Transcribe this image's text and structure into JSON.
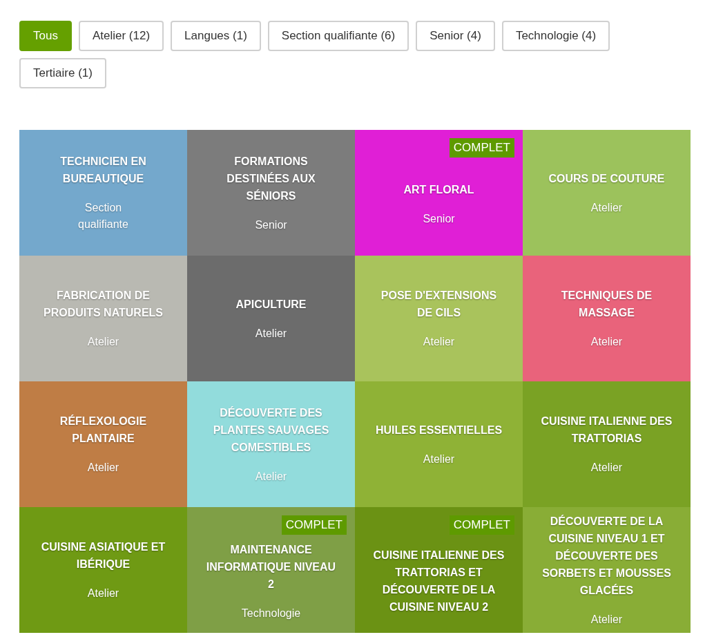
{
  "filters": [
    {
      "label": "Tous",
      "selected": true
    },
    {
      "label": "Atelier (12)",
      "selected": false
    },
    {
      "label": "Langues (1)",
      "selected": false
    },
    {
      "label": "Section qualifiante (6)",
      "selected": false
    },
    {
      "label": "Senior (4)",
      "selected": false
    },
    {
      "label": "Technologie (4)",
      "selected": false
    },
    {
      "label": "Tertiaire (1)",
      "selected": false
    }
  ],
  "courses": [
    {
      "title": "TECHNICIEN EN BUREAUTIQUE",
      "category": "Section qualifiante",
      "color": "#74a8cc"
    },
    {
      "title": "FORMATIONS DESTINÉES AUX SÉNIORS",
      "category": "Senior",
      "color": "#7c7c7c"
    },
    {
      "title": "ART FLORAL",
      "category": "Senior",
      "color": "#e01fd6",
      "badge": "COMPLET"
    },
    {
      "title": "COURS DE COUTURE",
      "category": "Atelier",
      "color": "#9cc25c"
    },
    {
      "title": "FABRICATION DE PRODUITS NATURELS",
      "category": "Atelier",
      "color": "#b9b9b2"
    },
    {
      "title": "APICULTURE",
      "category": "Atelier",
      "color": "#6c6c6c"
    },
    {
      "title": "POSE D'EXTENSIONS DE CILS",
      "category": "Atelier",
      "color": "#a9c35c"
    },
    {
      "title": "TECHNIQUES DE MASSAGE",
      "category": "Atelier",
      "color": "#e9637b"
    },
    {
      "title": "RÉFLEXOLOGIE PLANTAIRE",
      "category": "Atelier",
      "color": "#bf7d45"
    },
    {
      "title": "DÉCOUVERTE DES PLANTES SAUVAGES COMESTIBLES",
      "category": "Atelier",
      "color": "#92dcdc"
    },
    {
      "title": "HUILES ESSENTIELLES",
      "category": "Atelier",
      "color": "#8fb236"
    },
    {
      "title": "CUISINE ITALIENNE DES TRATTORIAS",
      "category": "Atelier",
      "color": "#7aa224"
    },
    {
      "title": "CUISINE ASIATIQUE ET IBÉRIQUE",
      "category": "Atelier",
      "color": "#6f9a14"
    },
    {
      "title": "MAINTENANCE INFORMATIQUE NIVEAU 2",
      "category": "Technologie",
      "color": "#7f9f46",
      "badge": "COMPLET"
    },
    {
      "title": "CUISINE ITALIENNE DES TRATTORIAS ET DÉCOUVERTE DE LA CUISINE NIVEAU 2",
      "color": "#6b9214",
      "badge": "COMPLET"
    },
    {
      "title": "DÉCOUVERTE DE LA CUISINE NIVEAU 1 ET DÉCOUVERTE DES SORBETS ET MOUSSES GLACÉES",
      "category": "Atelier",
      "color": "#89ad36"
    }
  ]
}
